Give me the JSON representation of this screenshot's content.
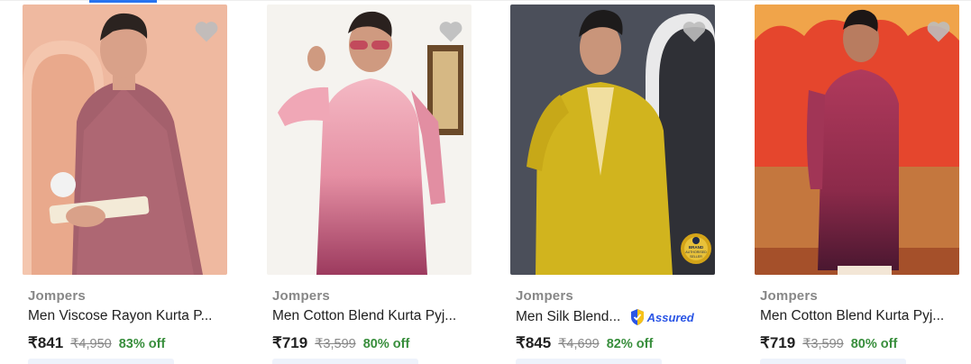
{
  "colors": {
    "accent": "#2874f0",
    "brand_text": "#878787",
    "title_text": "#212121",
    "discount_green": "#388e3c",
    "heart_grey": "#bdbdbd",
    "assured_blue": "#2a55e5"
  },
  "products": [
    {
      "brand": "Jompers",
      "title": "Men Viscose Rayon Kurta P...",
      "price": "₹841",
      "mrp": "₹4,950",
      "discount": "83% off",
      "assured": false,
      "wishlist_icon": "heart-icon",
      "image_desc": "Man in mauve printed kurta holding a book"
    },
    {
      "brand": "Jompers",
      "title": "Men Cotton Blend Kurta Pyj...",
      "price": "₹719",
      "mrp": "₹3,599",
      "discount": "80% off",
      "assured": false,
      "wishlist_icon": "heart-icon",
      "image_desc": "Man in pink ombre kurta with sunglasses"
    },
    {
      "brand": "Jompers",
      "title": "Men Silk Blend...",
      "price": "₹845",
      "mrp": "₹4,699",
      "discount": "82% off",
      "assured": true,
      "assured_label": "Assured",
      "badge_lines": [
        "BRAND",
        "AUTHORISED",
        "SELLER"
      ],
      "wishlist_icon": "heart-icon",
      "image_desc": "Man in mustard embroidered silk kurta"
    },
    {
      "brand": "Jompers",
      "title": "Men Cotton Blend Kurta Pyj...",
      "price": "₹719",
      "mrp": "₹3,599",
      "discount": "80% off",
      "assured": false,
      "wishlist_icon": "heart-icon",
      "image_desc": "Man in maroon ombre kurta against red wall"
    }
  ]
}
